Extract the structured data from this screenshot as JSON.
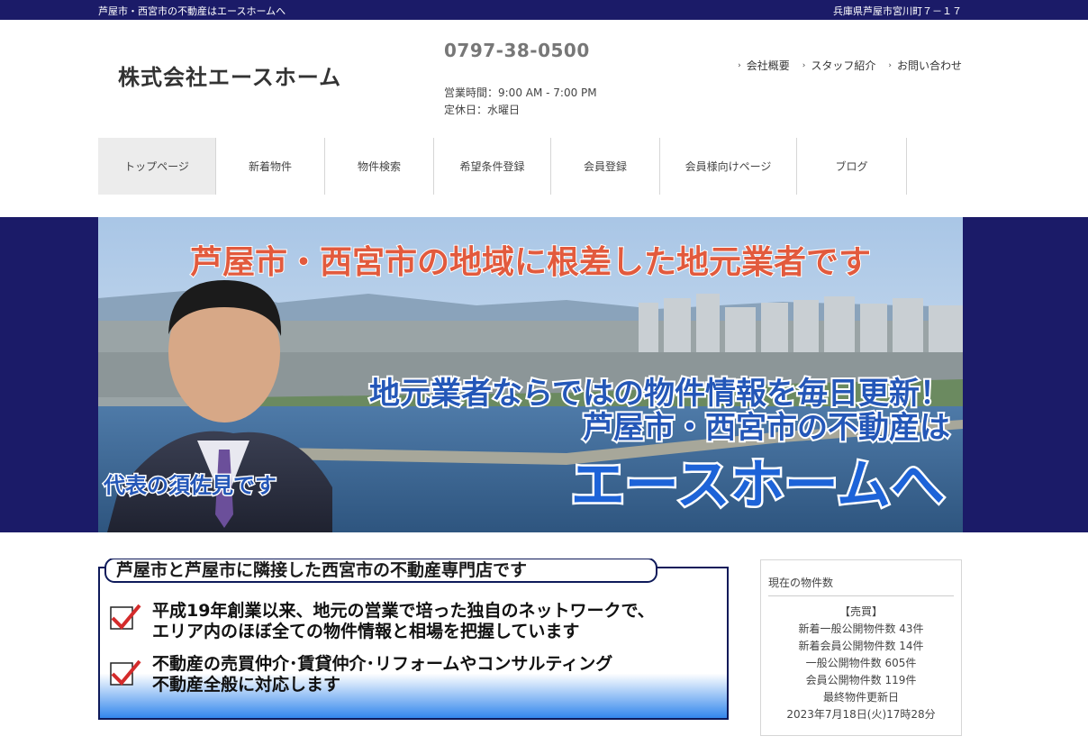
{
  "topbar": {
    "tagline": "芦屋市・西宮市の不動産はエースホームへ",
    "address": "兵庫県芦屋市宮川町７－１７"
  },
  "header": {
    "logo": "株式会社エースホーム",
    "phone": "0797-38-0500",
    "hours": "営業時間：9:00 AM - 7:00 PM",
    "holiday": "定休日：水曜日",
    "links": [
      "会社概要",
      "スタッフ紹介",
      "お問い合わせ"
    ]
  },
  "nav": {
    "items": [
      "トップページ",
      "新着物件",
      "物件検索",
      "希望条件登録",
      "会員登録",
      "会員様向けページ",
      "ブログ"
    ],
    "active": "トップページ"
  },
  "banner": {
    "headline": "芦屋市・西宮市の地域に根差した地元業者です",
    "line1": "地元業者ならではの物件情報を毎日更新！",
    "line2": "芦屋市・西宮市の不動産は",
    "line3": "エースホームへ",
    "caption": "代表の須佐見です"
  },
  "intro": {
    "title": "芦屋市と芦屋市に隣接した西宮市の不動産専門店です",
    "points": [
      {
        "line1": "平成19年創業以来、地元の営業で培った独自のネットワークで、",
        "line2": "エリア内のほぼ全ての物件情報と相場を把握しています"
      },
      {
        "line1": "不動産の売買仲介･賃貸仲介･リフォームやコンサルティング",
        "line2": "不動産全般に対応します"
      }
    ]
  },
  "stats": {
    "heading": "現在の物件数",
    "category": "【売買】",
    "rows": [
      "新着一般公開物件数 43件",
      "新着会員公開物件数 14件",
      "一般公開物件数 605件",
      "会員公開物件数 119件",
      "最終物件更新日",
      "2023年7月18日(火)17時28分"
    ]
  },
  "colors": {
    "navy": "#1b1b68",
    "headline_red": "#e25a3d",
    "headline_blue": "#2457b8",
    "accent_blue": "#1d63d8",
    "check_red": "#d42b2b"
  }
}
